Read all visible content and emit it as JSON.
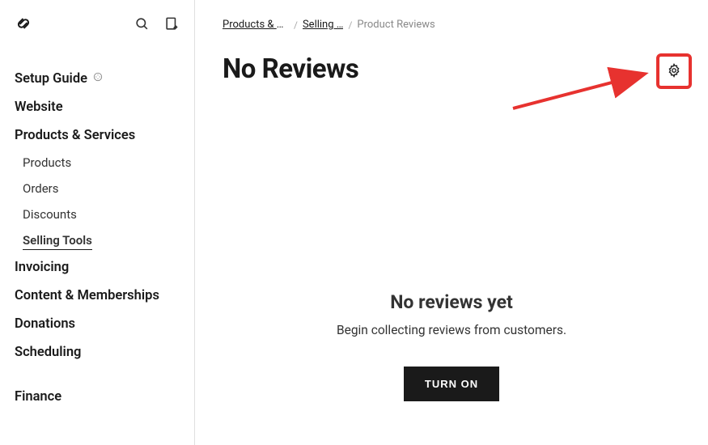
{
  "sidebar": {
    "nav": [
      {
        "label": "Setup Guide",
        "icon": true
      },
      {
        "label": "Website"
      },
      {
        "label": "Products & Services",
        "children": [
          {
            "label": "Products"
          },
          {
            "label": "Orders"
          },
          {
            "label": "Discounts"
          },
          {
            "label": "Selling Tools",
            "active": true
          }
        ]
      },
      {
        "label": "Invoicing"
      },
      {
        "label": "Content & Memberships"
      },
      {
        "label": "Donations"
      },
      {
        "label": "Scheduling"
      }
    ],
    "secondary": [
      {
        "label": "Finance"
      }
    ]
  },
  "breadcrumb": {
    "items": [
      {
        "label": "Products & S…"
      },
      {
        "label": "Selling …"
      }
    ],
    "current": "Product Reviews"
  },
  "page": {
    "title": "No Reviews"
  },
  "empty": {
    "title": "No reviews yet",
    "subtitle": "Begin collecting reviews from customers.",
    "button": "TURN ON"
  },
  "annotation": {
    "color": "#e7322f"
  }
}
